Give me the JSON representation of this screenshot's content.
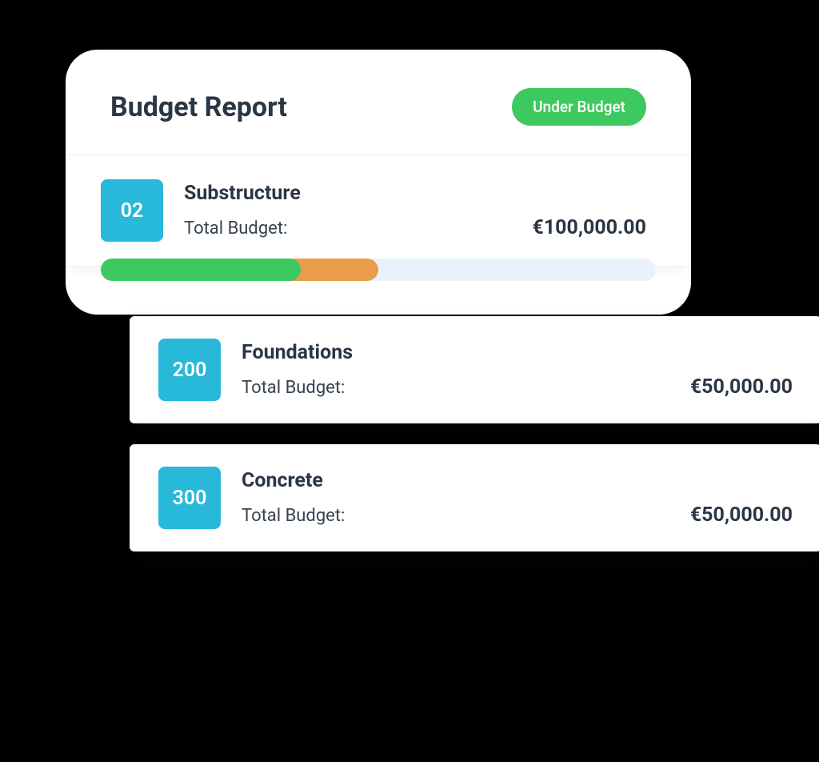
{
  "header": {
    "title": "Budget Report",
    "status_badge": "Under Budget"
  },
  "main_item": {
    "code": "02",
    "name": "Substructure",
    "budget_label": "Total Budget:",
    "budget_value": "€100,000.00"
  },
  "sub_items": [
    {
      "code": "200",
      "name": "Foundations",
      "budget_label": "Total Budget:",
      "budget_value": "€50,000.00"
    },
    {
      "code": "300",
      "name": "Concrete",
      "budget_label": "Total Budget:",
      "budget_value": "€50,000.00"
    }
  ],
  "progress": {
    "green_percent": 36,
    "orange_percent": 50
  }
}
